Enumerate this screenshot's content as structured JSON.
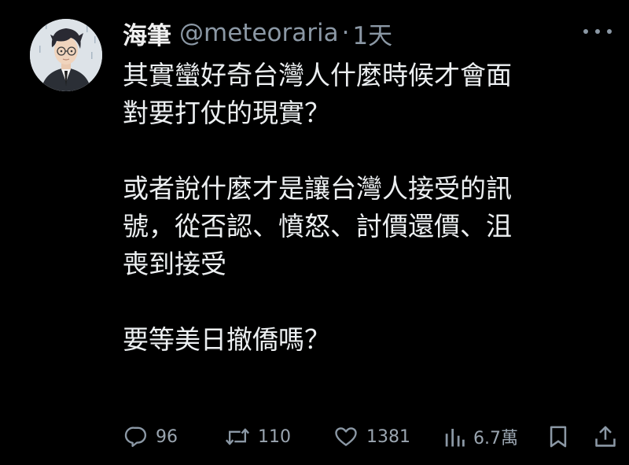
{
  "user": {
    "display_name": "海筆",
    "handle": "@meteoraria",
    "separator": "·",
    "time": "1天",
    "avatar": "illustrated-avatar"
  },
  "tweet": {
    "paragraphs": [
      [
        "其實蠻好奇台灣人什麼時候才會面",
        "對要打仗的現實？"
      ],
      [
        "或者說什麼才是讓台灣人接受的訊",
        "號，從否認、憤怒、討價還價、沮",
        "喪到接受"
      ],
      [
        "要等美日撤僑嗎？"
      ]
    ]
  },
  "actions": {
    "replies": "96",
    "retweets": "110",
    "likes": "1381",
    "views": "6.7萬"
  },
  "icons": {
    "reply": "reply-icon",
    "retweet": "retweet-icon",
    "like": "heart-icon",
    "views": "analytics-icon",
    "bookmark": "bookmark-icon",
    "share": "share-icon",
    "more": "more-icon"
  },
  "colors": {
    "background": "#000000",
    "text": "#e7e9ea",
    "secondary": "#8b98a5"
  }
}
